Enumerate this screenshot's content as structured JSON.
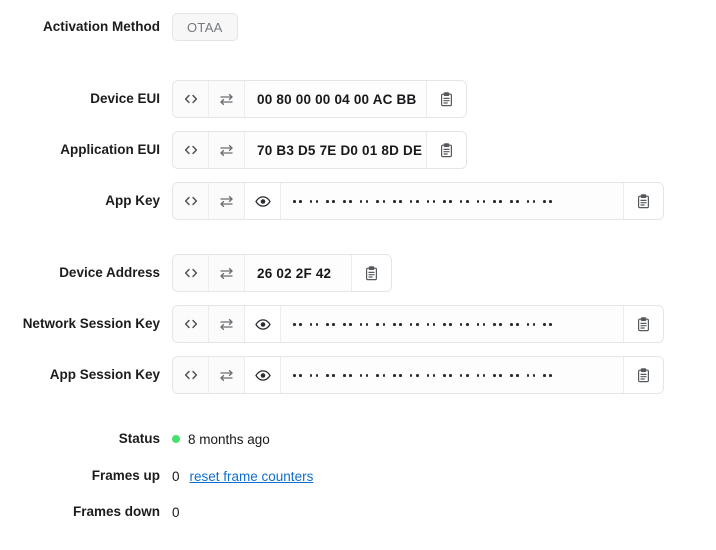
{
  "rows": {
    "activation": {
      "label": "Activation Method",
      "value": "OTAA"
    },
    "device_eui": {
      "label": "Device EUI",
      "value": "00 80 00 00 04 00 AC BB"
    },
    "application_eui": {
      "label": "Application EUI",
      "value": "70 B3 D5 7E D0 01 8D DE"
    },
    "app_key": {
      "label": "App Key",
      "value": "",
      "masked": true,
      "masked_groups": 16,
      "dots_per_group": 2
    },
    "device_address": {
      "label": "Device Address",
      "value": "26 02 2F 42"
    },
    "network_session_key": {
      "label": "Network Session Key",
      "value": "",
      "masked": true,
      "masked_groups": 16,
      "dots_per_group": 2
    },
    "app_session_key": {
      "label": "App Session Key",
      "value": "",
      "masked": true,
      "masked_groups": 16,
      "dots_per_group": 2
    },
    "status": {
      "label": "Status",
      "value": "8 months ago",
      "indicator_color": "#45e06a"
    },
    "frames_up": {
      "label": "Frames up",
      "value": "0",
      "action_label": "reset frame counters",
      "action_color": "#0f6ecd"
    },
    "frames_down": {
      "label": "Frames down",
      "value": "0"
    }
  },
  "icons": {
    "code": "code-icon",
    "swap": "swap-icon",
    "eye": "eye-icon",
    "copy": "clipboard-copy-icon"
  }
}
